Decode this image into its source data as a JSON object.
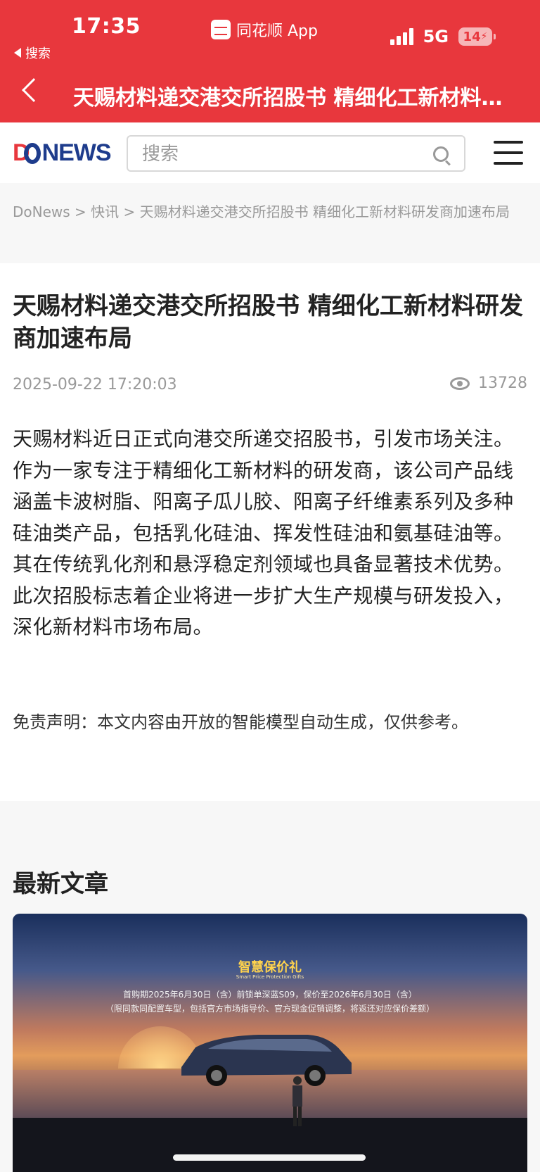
{
  "status_bar": {
    "time": "17:35",
    "back_app": "搜索",
    "app_name": "同花顺 App",
    "network": "5G",
    "battery": "14"
  },
  "nav": {
    "title": "天赐材料递交港交所招股书 精细化工新材料…"
  },
  "site_header": {
    "logo_d": "D",
    "logo_rest": "NEWS",
    "search_placeholder": "搜索"
  },
  "breadcrumb": {
    "text": "DoNews > 快讯 > 天赐材料递交港交所招股书 精细化工新材料研发商加速布局"
  },
  "article": {
    "title": "天赐材料递交港交所招股书 精细化工新材料研发商加速布局",
    "date": "2025-09-22 17:20:03",
    "views": "13728",
    "body": "天赐材料近日正式向港交所递交招股书，引发市场关注。作为一家专注于精细化工新材料的研发商，该公司产品线涵盖卡波树脂、阳离子瓜儿胶、阳离子纤维素系列及多种硅油类产品，包括乳化硅油、挥发性硅油和氨基硅油等。其在传统乳化剂和悬浮稳定剂领域也具备显著技术优势。此次招股标志着企业将进一步扩大生产规模与研发投入，深化新材料市场布局。",
    "disclaimer": "免责声明：本文内容由开放的智能模型自动生成，仅供参考。"
  },
  "latest": {
    "heading": "最新文章",
    "card": {
      "promo_title": "智慧保价礼",
      "promo_subtitle": "Smart Price Protection Gifts",
      "promo_line1": "首购期2025年6月30日（含）前锁单深蓝S09，保价至2026年6月30日（含）",
      "promo_line2": "（限同款同配置车型，包括官方市场指导价、官方现金促销调整，将返还对应保价差额）"
    }
  },
  "colors": {
    "brand_red": "#e8373d",
    "logo_blue": "#1e3c8c"
  }
}
